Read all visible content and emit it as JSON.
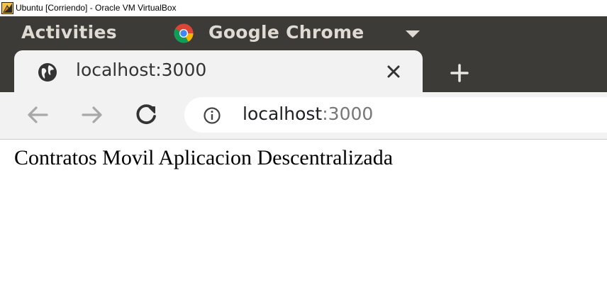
{
  "host_window": {
    "title": "Ubuntu [Corriendo] - Oracle VM VirtualBox"
  },
  "top_panel": {
    "activities_label": "Activities",
    "app_name": "Google Chrome"
  },
  "browser": {
    "tab": {
      "title": "localhost:3000"
    },
    "address_bar": {
      "host": "localhost",
      "port": ":3000"
    }
  },
  "page": {
    "heading": "Contratos Movil Aplicacion Descentralizada"
  },
  "colors": {
    "panel_bg": "#3c3b37",
    "toolbar_bg": "#f2f2f2",
    "panel_text": "#dfdbd2"
  }
}
